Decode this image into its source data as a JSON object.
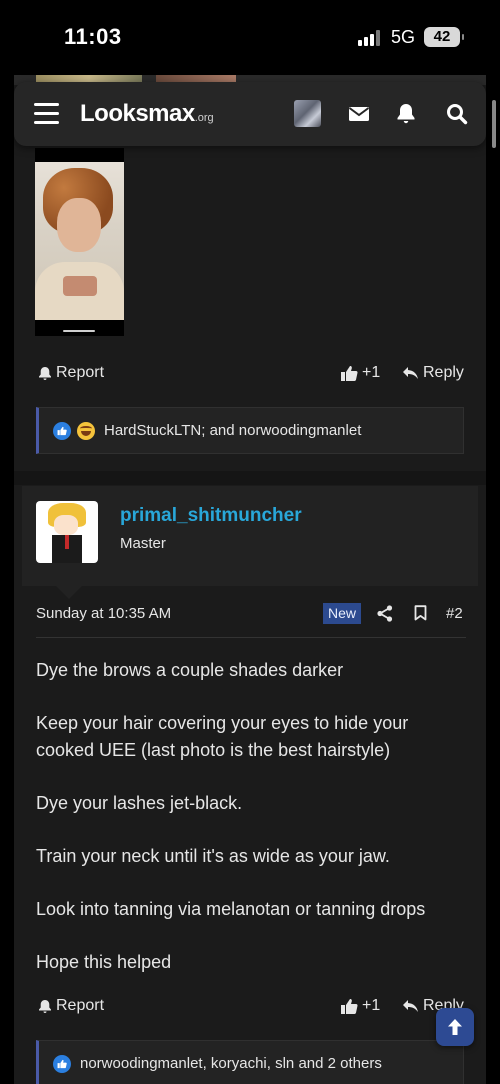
{
  "status_bar": {
    "time": "11:03",
    "network": "5G",
    "battery": "42"
  },
  "header": {
    "logo_main": "Looksmax",
    "logo_tld": ".org"
  },
  "post1": {
    "report_label": "Report",
    "like_count": "+1",
    "reply_label": "Reply",
    "reactions_text": "HardStuckLTN; and norwoodingmanlet"
  },
  "post2": {
    "username": "primal_shitmuncher",
    "user_title": "Master",
    "date": "Sunday at 10:35 AM",
    "new_badge": "New",
    "post_number": "#2",
    "paragraphs": [
      "Dye the brows a couple shades darker",
      "Keep your hair covering your eyes to hide your cooked UEE (last photo is the best hairstyle)",
      "Dye your lashes jet-black.",
      "Train your neck until it's as wide as your jaw.",
      "Look into tanning via melanotan or tanning drops",
      "Hope this helped"
    ],
    "report_label": "Report",
    "like_count": "+1",
    "reply_label": "Reply",
    "reactions_text": "norwoodingmanlet, koryachi, sln and 2 others"
  },
  "colors": {
    "accent_link": "#29a7d9",
    "badge_bg": "#2c4a8f",
    "reaction_border": "#4a5aa8"
  }
}
